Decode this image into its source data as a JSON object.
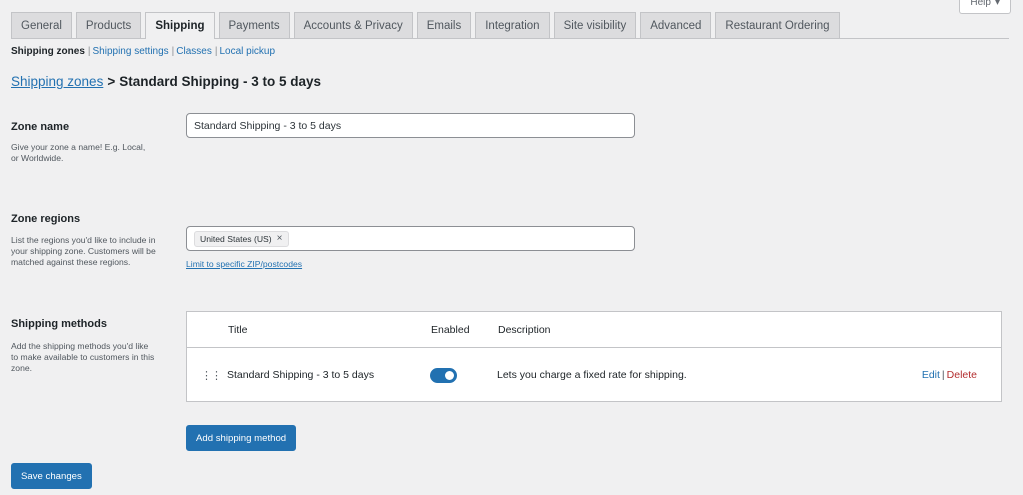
{
  "help": {
    "label": "Help",
    "arrow": "▾"
  },
  "tabs": [
    {
      "label": "General",
      "active": false
    },
    {
      "label": "Products",
      "active": false
    },
    {
      "label": "Shipping",
      "active": true
    },
    {
      "label": "Payments",
      "active": false
    },
    {
      "label": "Accounts & Privacy",
      "active": false
    },
    {
      "label": "Emails",
      "active": false
    },
    {
      "label": "Integration",
      "active": false
    },
    {
      "label": "Site visibility",
      "active": false
    },
    {
      "label": "Advanced",
      "active": false
    },
    {
      "label": "Restaurant Ordering",
      "active": false
    }
  ],
  "subnav": {
    "items": [
      "Shipping zones",
      "Shipping settings",
      "Classes",
      "Local pickup"
    ],
    "separator": "|"
  },
  "breadcrumb": {
    "link": "Shipping zones",
    "separator": ">",
    "current": "Standard Shipping - 3 to 5 days"
  },
  "zone_name": {
    "label": "Zone name",
    "description": "Give your zone a name! E.g. Local, or Worldwide.",
    "value": "Standard Shipping - 3 to 5 days"
  },
  "zone_regions": {
    "label": "Zone regions",
    "description": "List the regions you'd like to include in your shipping zone. Customers will be matched against these regions.",
    "chips": [
      "United States (US)"
    ],
    "chip_remove": "×",
    "zip_link": "Limit to specific ZIP/postcodes"
  },
  "shipping_methods": {
    "label": "Shipping methods",
    "description": "Add the shipping methods you'd like to make available to customers in this zone.",
    "columns": {
      "title": "Title",
      "enabled": "Enabled",
      "description": "Description"
    },
    "rows": [
      {
        "drag": "⋮⋮",
        "title": "Standard Shipping - 3 to 5 days",
        "enabled": true,
        "description": "Lets you charge a fixed rate for shipping.",
        "edit": "Edit",
        "action_sep": "|",
        "delete": "Delete"
      }
    ],
    "add_button": "Add shipping method"
  },
  "save_button": "Save changes",
  "colors": {
    "accent": "#2271b1",
    "delete": "#b32d2e",
    "background": "#f0f0f1"
  }
}
